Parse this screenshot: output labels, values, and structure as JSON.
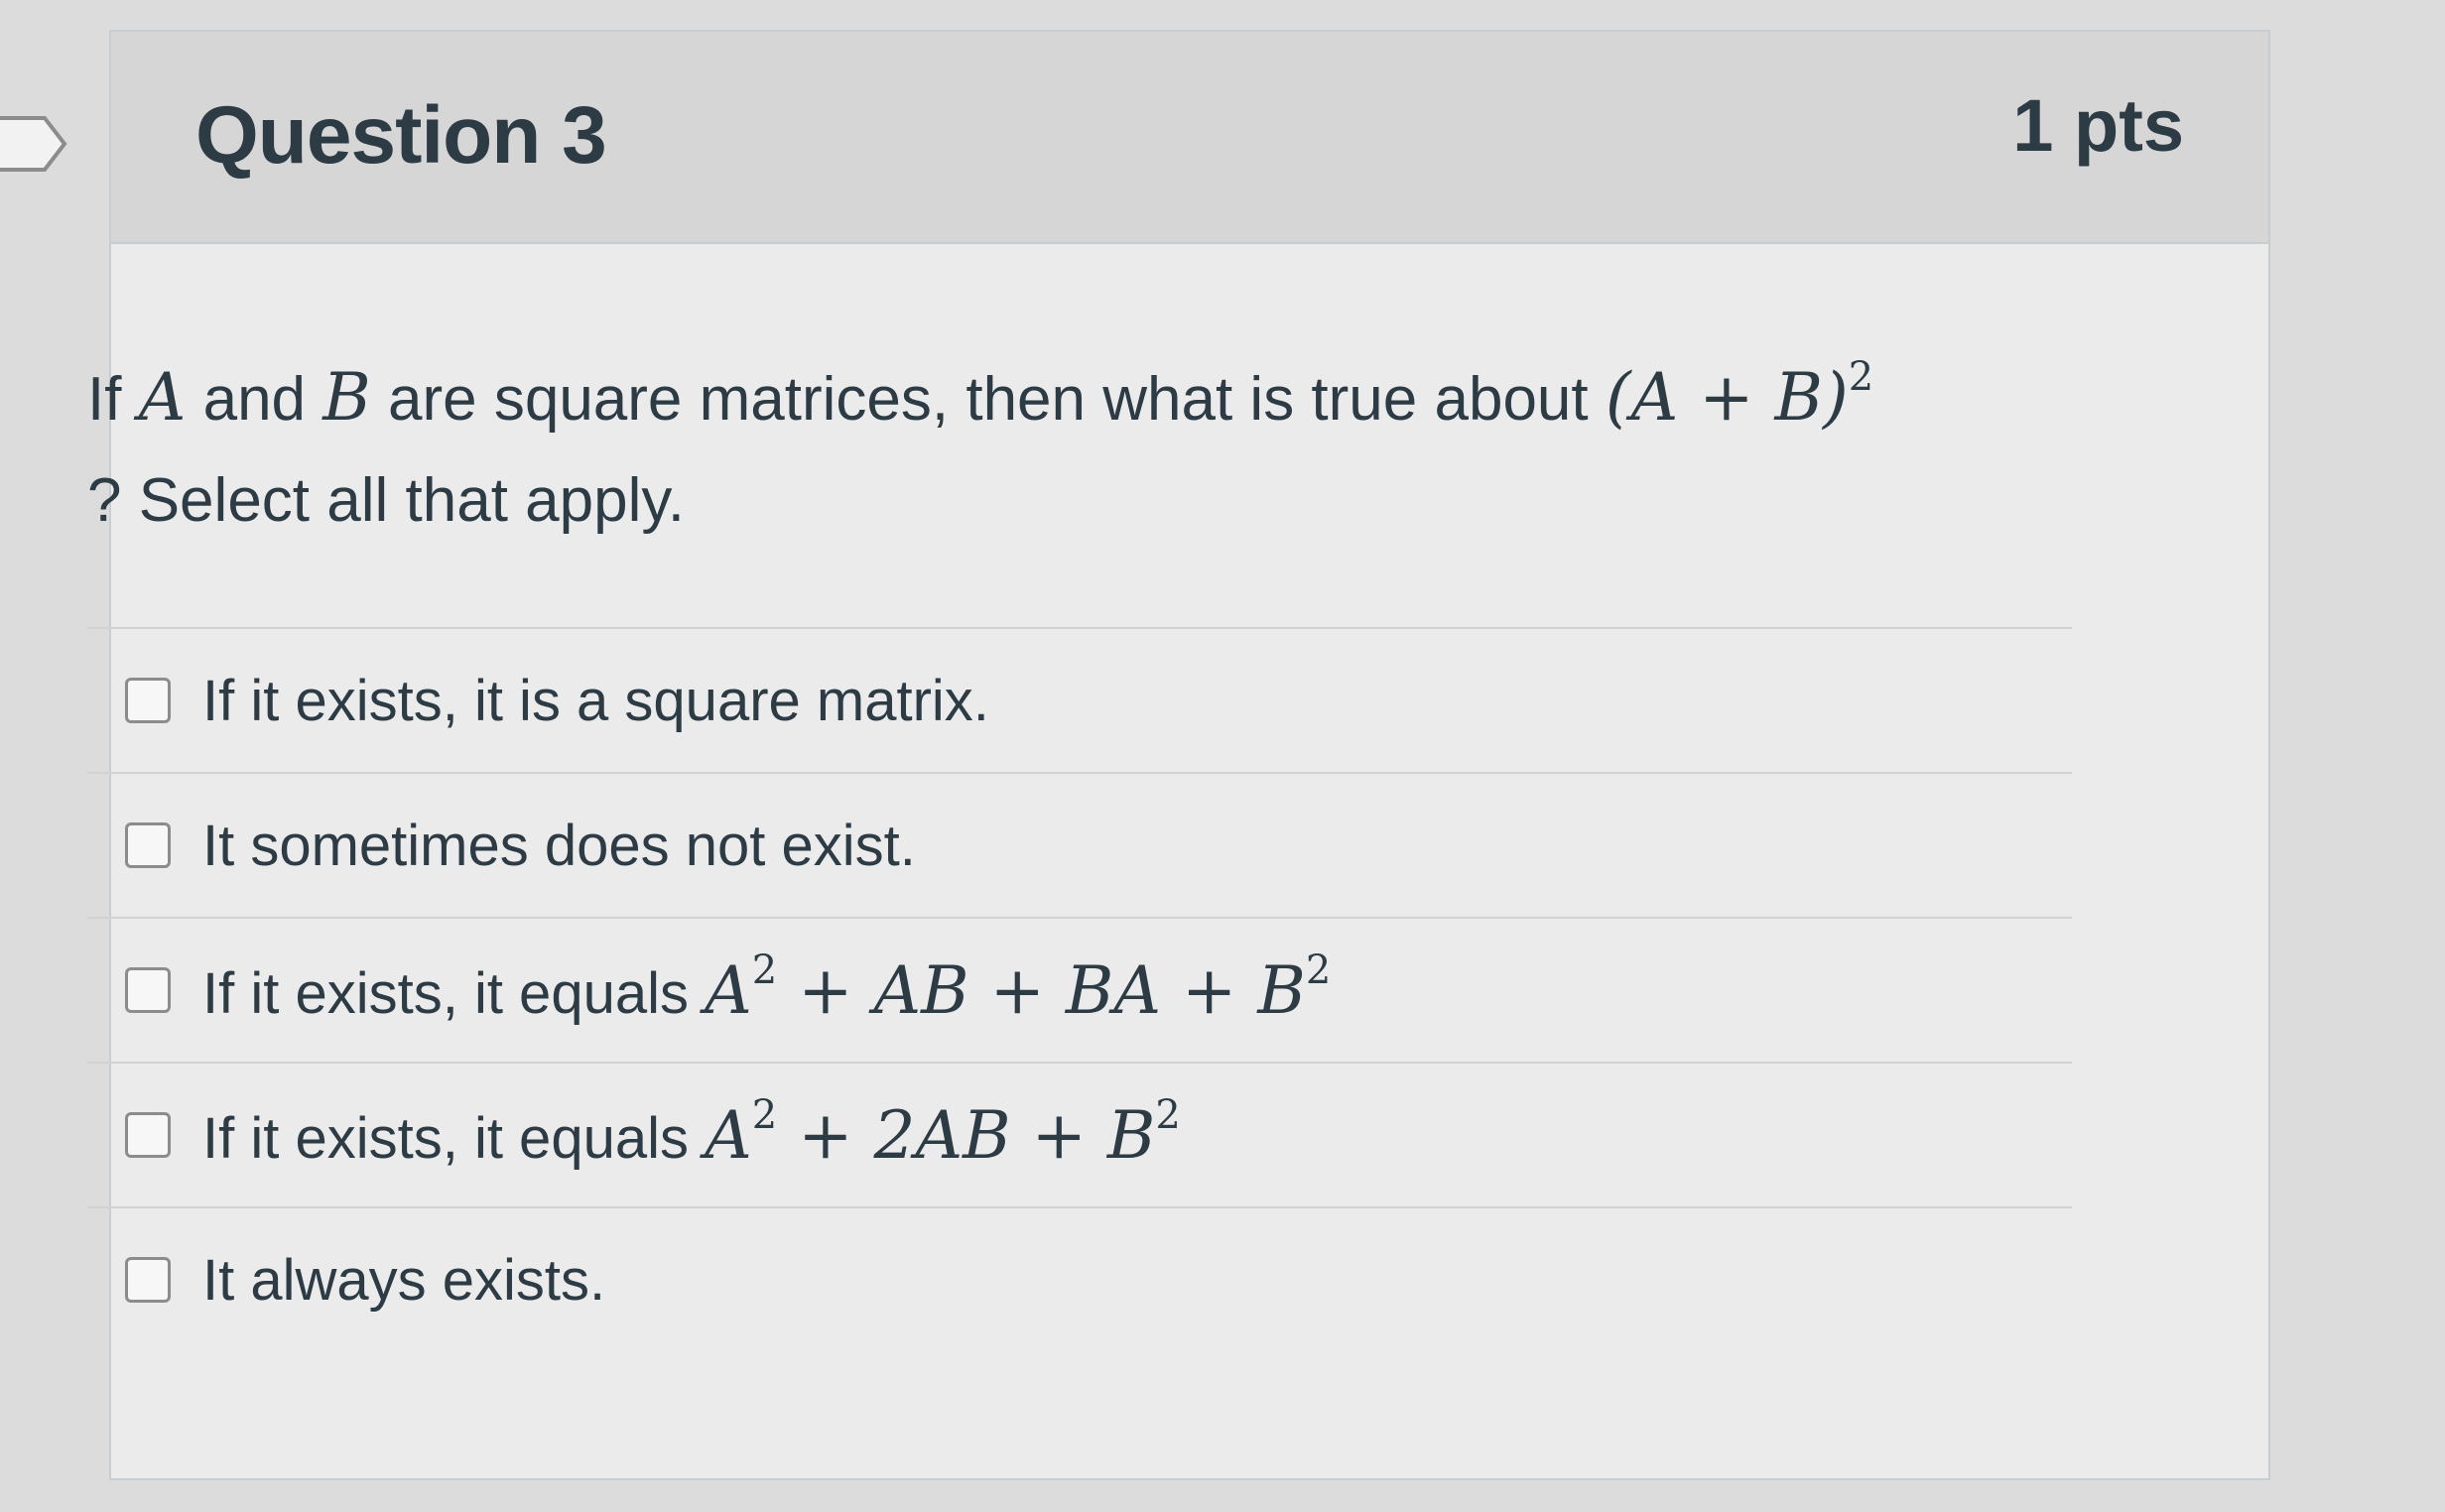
{
  "question": {
    "title": "Question 3",
    "points": "1 pts",
    "text": {
      "prefix": "If ",
      "var_a": "A",
      "and": " and ",
      "var_b": "B",
      "middle": " are square matrices, then what is true about ",
      "expr": "(A + B)",
      "expr_exp": "2",
      "suffix": "? Select all that apply."
    }
  },
  "answers": [
    {
      "label": "If it exists, it is a square matrix.",
      "checked": false
    },
    {
      "label": "It sometimes does not exist.",
      "checked": false
    },
    {
      "label_text": "If it exists, it equals ",
      "math": {
        "t1": "A",
        "t1_exp": "2",
        "t2": " + AB + BA + B",
        "t2_exp": "2"
      },
      "checked": false
    },
    {
      "label_text": "If it exists, it equals ",
      "math": {
        "t1": "A",
        "t1_exp": "2",
        "t2": " + 2AB + B",
        "t2_exp": "2"
      },
      "checked": false
    },
    {
      "label": "It always exists.",
      "checked": false
    }
  ],
  "colors": {
    "text": "#2d3b45",
    "header_bg": "#d6d6d6",
    "body_bg": "#ebebeb",
    "border": "#c7cdd1"
  }
}
